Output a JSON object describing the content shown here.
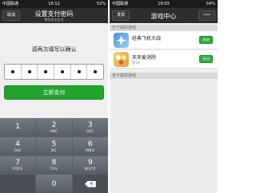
{
  "left": {
    "status": {
      "carrier": "中国联通",
      "time": "16:12",
      "battery": "52%"
    },
    "nav": {
      "cancel_label": "取消",
      "title": "设置支付密码",
      "subtitle": "微信安全支付"
    },
    "prompt": "请再次填写以确认",
    "pin_filled": 6,
    "pay_button": "立即支付",
    "keypad": [
      {
        "num": "1",
        "letters": ""
      },
      {
        "num": "2",
        "letters": "ABC"
      },
      {
        "num": "3",
        "letters": "DEF"
      },
      {
        "num": "4",
        "letters": "GHI"
      },
      {
        "num": "5",
        "letters": "JKL"
      },
      {
        "num": "6",
        "letters": "MNO"
      },
      {
        "num": "7",
        "letters": "PQRS"
      },
      {
        "num": "8",
        "letters": "TUV"
      },
      {
        "num": "9",
        "letters": "WXYZ"
      },
      {
        "num": "",
        "letters": ""
      },
      {
        "num": "0",
        "letters": ""
      }
    ],
    "backspace_icon": "backspace-icon"
  },
  "right": {
    "status": {
      "carrier": "中国联通",
      "time": "16:03",
      "battery": "54%"
    },
    "nav": {
      "back_label": "发现",
      "title": "游戏中心",
      "more_label": "•••"
    },
    "downloaded_header": "已下载的游戏",
    "games": [
      {
        "name": "经典飞机大战",
        "sub": "",
        "button": "启动",
        "icon": "plane-game-icon"
      },
      {
        "name": "天天爱消除",
        "sub": "第1名",
        "button": "启动",
        "icon": "pets-game-icon"
      }
    ],
    "not_downloaded_header": "未下载的游戏"
  }
}
